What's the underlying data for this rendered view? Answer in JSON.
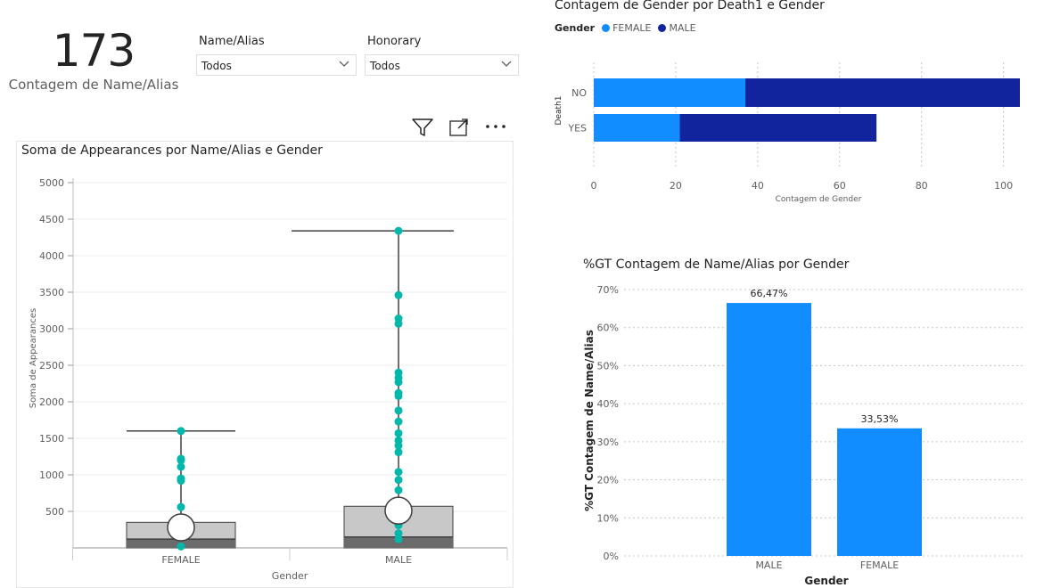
{
  "kpi": {
    "value": "173",
    "label": "Contagem de Name/Alias"
  },
  "slicers": [
    {
      "title": "Name/Alias",
      "value": "Todos"
    },
    {
      "title": "Honorary",
      "value": "Todos"
    }
  ],
  "toolbar": {
    "filter_icon": "filter-icon",
    "focus_icon": "focus-mode-icon",
    "more_icon": "more-options-icon"
  },
  "boxplot": {
    "title": "Soma de Appearances por Name/Alias e Gender",
    "xlabel": "Gender",
    "ylabel": "Soma de Appearances"
  },
  "hbar": {
    "title": "Contagem de Gender por Death1 e Gender",
    "legend_title": "Gender",
    "xlabel": "Contagem de Gender",
    "ylabel": "Death1"
  },
  "pct": {
    "title": "%GT Contagem de Name/Alias por Gender",
    "xlabel": "Gender",
    "ylabel": "%GT Contagem de Name/Alias"
  },
  "colors": {
    "female": "#118dff",
    "male": "#12239e",
    "teal": "#01b8aa",
    "box": "#c8c8c8",
    "box_dark": "#6b6b6b"
  },
  "chart_data": [
    {
      "type": "bar",
      "title": "Soma de Appearances por Name/Alias e Gender",
      "xlabel": "Gender",
      "ylabel": "Soma de Appearances",
      "categories": [
        "FEMALE",
        "MALE"
      ],
      "ylim": [
        0,
        5000
      ],
      "yticks": [
        500,
        1000,
        1500,
        2000,
        2500,
        3000,
        3500,
        4000,
        4500,
        5000
      ],
      "groups": [
        {
          "name": "FEMALE",
          "min": 0,
          "q1": 0,
          "median": 120,
          "q3": 350,
          "max": 1600,
          "mean": 280,
          "points": [
            1600,
            1220,
            1200,
            1110,
            950,
            920,
            560,
            20
          ]
        },
        {
          "name": "MALE",
          "min": 0,
          "q1": 0,
          "median": 150,
          "q3": 570,
          "max": 4340,
          "mean": 510,
          "points": [
            4340,
            3460,
            3140,
            3070,
            2400,
            2330,
            2270,
            2120,
            2080,
            1880,
            1730,
            1570,
            1470,
            1400,
            1310,
            1040,
            930,
            790,
            530,
            310,
            200,
            120
          ]
        }
      ]
    },
    {
      "type": "bar",
      "title": "Contagem de Gender por Death1 e Gender",
      "orientation": "horizontal",
      "stacked": true,
      "categories": [
        "NO",
        "YES"
      ],
      "xlabel": "Contagem de Gender",
      "ylabel": "Death1",
      "xlim": [
        0,
        104
      ],
      "xticks": [
        0,
        20,
        40,
        60,
        80,
        100
      ],
      "series": [
        {
          "name": "FEMALE",
          "values": [
            37,
            21
          ]
        },
        {
          "name": "MALE",
          "values": [
            67,
            48
          ]
        }
      ]
    },
    {
      "type": "bar",
      "title": "%GT Contagem de Name/Alias por Gender",
      "categories": [
        "MALE",
        "FEMALE"
      ],
      "values": [
        66.47,
        33.53
      ],
      "data_labels": [
        "66,47%",
        "33,53%"
      ],
      "xlabel": "Gender",
      "ylabel": "%GT Contagem de Name/Alias",
      "ylim": [
        0,
        70
      ],
      "yticks": [
        "0%",
        "10%",
        "20%",
        "30%",
        "40%",
        "50%",
        "60%",
        "70%"
      ]
    }
  ]
}
